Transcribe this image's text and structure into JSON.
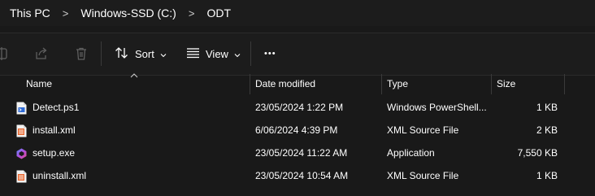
{
  "breadcrumb": {
    "items": [
      "This PC",
      "Windows-SSD (C:)",
      "ODT"
    ],
    "separator": ">"
  },
  "toolbar": {
    "sort_label": "Sort",
    "view_label": "View",
    "more_label": "•••"
  },
  "columns": {
    "name": "Name",
    "date": "Date modified",
    "type": "Type",
    "size": "Size"
  },
  "files": [
    {
      "name": "Detect.ps1",
      "date": "23/05/2024 1:22 PM",
      "type": "Windows PowerShell...",
      "size": "1 KB",
      "icon": "powershell-script-icon"
    },
    {
      "name": "install.xml",
      "date": "6/06/2024 4:39 PM",
      "type": "XML Source File",
      "size": "2 KB",
      "icon": "xml-file-icon"
    },
    {
      "name": "setup.exe",
      "date": "23/05/2024 11:22 AM",
      "type": "Application",
      "size": "7,550 KB",
      "icon": "office-setup-icon"
    },
    {
      "name": "uninstall.xml",
      "date": "23/05/2024 10:54 AM",
      "type": "XML Source File",
      "size": "1 KB",
      "icon": "xml-file-icon"
    }
  ],
  "colors": {
    "background": "#191919",
    "toolbar": "#1c1c1c",
    "separator": "#3a3a3a",
    "xml_accent": "#e8642c",
    "text": "#ffffff"
  }
}
